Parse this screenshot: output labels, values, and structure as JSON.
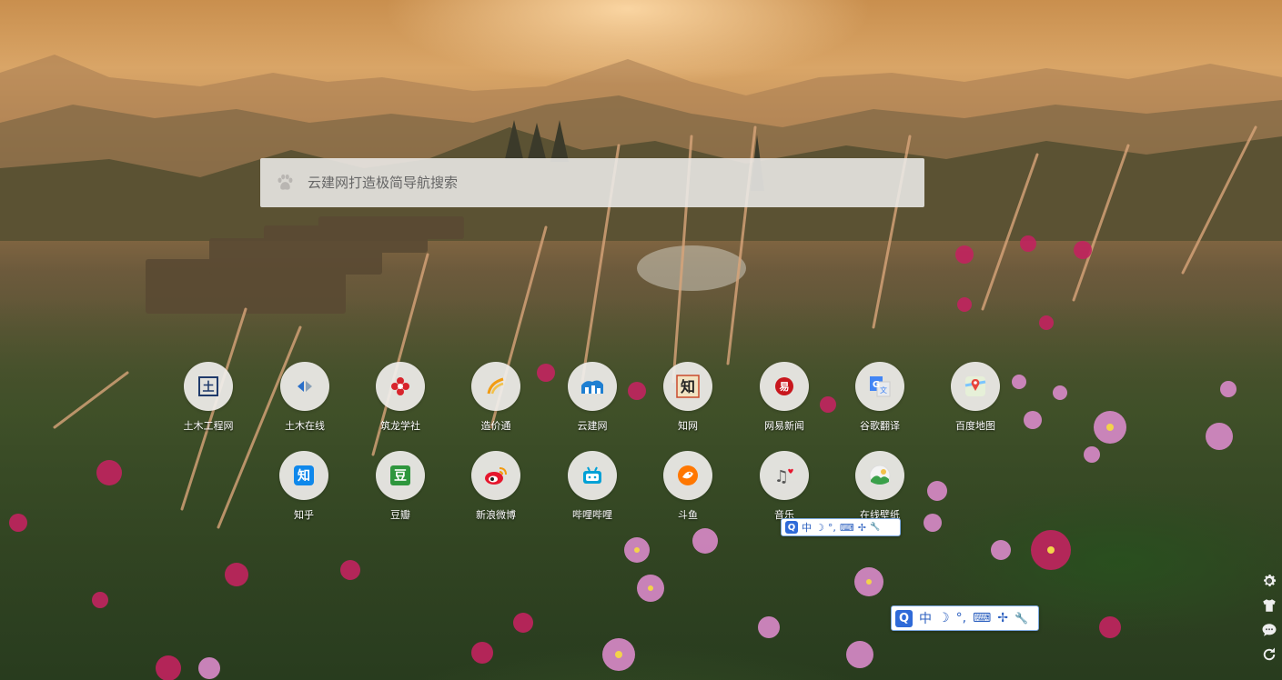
{
  "search": {
    "placeholder": "云建网打造极简导航搜索",
    "icon": "paw-icon"
  },
  "shortcuts": [
    {
      "label": "土木工程网",
      "icon": "tumu-gongcheng-icon",
      "color": "#1f3a6b"
    },
    {
      "label": "土木在线",
      "icon": "tumu-zaixian-icon",
      "color": "#2a6fc9"
    },
    {
      "label": "筑龙学社",
      "icon": "zhulong-icon",
      "color": "#d8242c"
    },
    {
      "label": "造价通",
      "icon": "zaojiatong-icon",
      "color": "#f29b11"
    },
    {
      "label": "云建网",
      "icon": "yunjianwang-icon",
      "color": "#1f7fd1"
    },
    {
      "label": "知网",
      "icon": "cnki-icon",
      "color": "#222222"
    },
    {
      "label": "网易新闻",
      "icon": "netease-news-icon",
      "color": "#c8161d"
    },
    {
      "label": "谷歌翻译",
      "icon": "google-translate-icon",
      "color": "#4285f4"
    },
    {
      "label": "百度地图",
      "icon": "baidu-map-icon",
      "color": "#e8453c"
    },
    {
      "label": "知乎",
      "icon": "zhihu-icon",
      "color": "#0f88eb"
    },
    {
      "label": "豆瓣",
      "icon": "douban-icon",
      "color": "#2e963d"
    },
    {
      "label": "新浪微博",
      "icon": "weibo-icon",
      "color": "#e6162d"
    },
    {
      "label": "哔哩哔哩",
      "icon": "bilibili-icon",
      "color": "#00a1d6"
    },
    {
      "label": "斗鱼",
      "icon": "douyu-icon",
      "color": "#ff7700"
    },
    {
      "label": "音乐",
      "icon": "music-icon",
      "color": "#555555"
    },
    {
      "label": "在线壁纸",
      "icon": "wallpaper-icon",
      "color": "#3aa04a"
    }
  ],
  "tile_glyphs": {
    "tumu": "土",
    "cnki": "知",
    "netease": "易",
    "zhihu": "知",
    "douban": "豆",
    "music": "♫"
  },
  "ime": {
    "logo": "Q",
    "mode": "中",
    "moon": "☽",
    "punct": "°,",
    "keyboard": "⌨",
    "separator": "✢",
    "tool": "🔧"
  },
  "sidebar": [
    {
      "name": "settings-gear-icon",
      "glyph": "⚙"
    },
    {
      "name": "skin-shirt-icon",
      "glyph": "👕"
    },
    {
      "name": "feedback-chat-icon",
      "glyph": "💬"
    },
    {
      "name": "refresh-icon",
      "glyph": "↻"
    }
  ]
}
